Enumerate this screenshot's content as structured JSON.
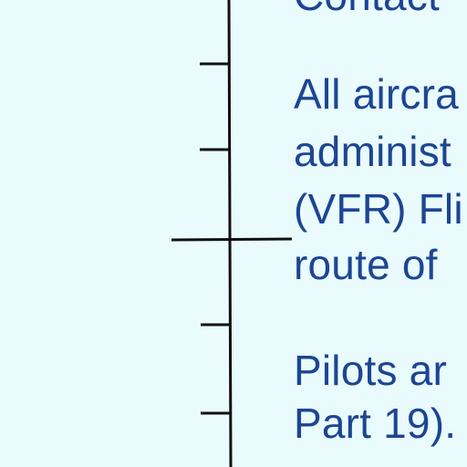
{
  "notes": {
    "lines": [
      "Contact",
      "All aircra",
      "administ",
      "(VFR) Fli",
      "route of",
      "Pilots ar",
      "Part 19)."
    ]
  },
  "colors": {
    "background": "#e9fbfc",
    "text": "#1d4593",
    "line": "#111111"
  }
}
